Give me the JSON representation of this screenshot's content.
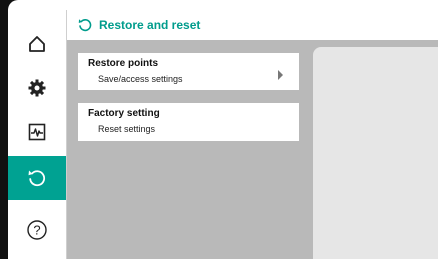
{
  "header": {
    "title": "Restore and reset",
    "icon": "restore-icon"
  },
  "sidebar": {
    "items": [
      {
        "icon": "home-icon",
        "active": false
      },
      {
        "icon": "gear-icon",
        "active": false
      },
      {
        "icon": "diagnostics-icon",
        "active": false
      },
      {
        "icon": "restore-icon",
        "active": true
      },
      {
        "icon": "help-icon",
        "active": false
      }
    ],
    "active_color": "#00a292"
  },
  "cards": [
    {
      "title": "Restore points",
      "item": "Save/access settings",
      "has_arrow": true
    },
    {
      "title": "Factory setting",
      "item": "Reset settings",
      "has_arrow": false
    }
  ],
  "colors": {
    "accent": "#009c8c",
    "content_bg": "#b9b9b9",
    "panel_bg": "#e6e6e6"
  }
}
